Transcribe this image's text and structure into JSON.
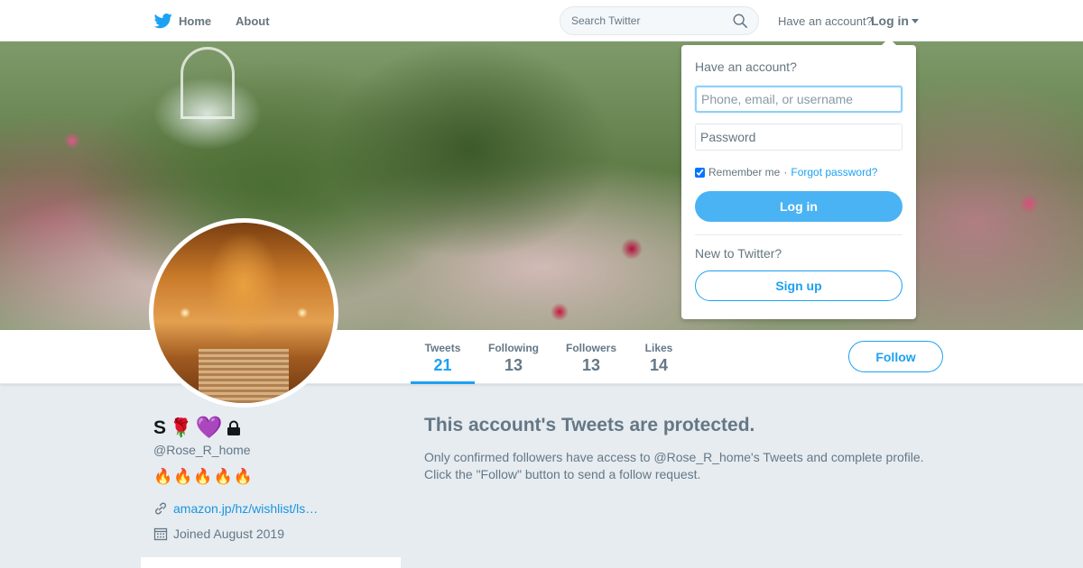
{
  "nav": {
    "home_label": "Home",
    "about_label": "About",
    "search_placeholder": "Search Twitter",
    "have_account": "Have an account?",
    "login_label": "Log in"
  },
  "login_dropdown": {
    "title": "Have an account?",
    "phone_placeholder": "Phone, email, or username",
    "password_placeholder": "Password",
    "remember_label": "Remember me",
    "separator": "·",
    "forgot_label": "Forgot password?",
    "remember_checked": true,
    "login_button": "Log in",
    "new_label": "New to Twitter?",
    "signup_button": "Sign up"
  },
  "stats": [
    {
      "label": "Tweets",
      "value": "21",
      "active": true
    },
    {
      "label": "Following",
      "value": "13",
      "active": false
    },
    {
      "label": "Followers",
      "value": "13",
      "active": false
    },
    {
      "label": "Likes",
      "value": "14",
      "active": false
    }
  ],
  "follow_button": "Follow",
  "profile": {
    "name": "S",
    "rose": "🌹",
    "heart": "💜",
    "handle": "@Rose_R_home",
    "bio": "🔥🔥🔥🔥🔥",
    "link": "amazon.jp/hz/wishlist/ls…",
    "joined": "Joined August 2019"
  },
  "protected": {
    "title": "This account's Tweets are protected.",
    "line1": "Only confirmed followers have access to @Rose_R_home's Tweets and complete profile.",
    "line2": "Click the \"Follow\" button to send a follow request."
  },
  "colors": {
    "accent": "#1da1f2",
    "login_button": "#4ab3f4",
    "muted_text": "#657786",
    "page_background": "#e6ecf0"
  },
  "icons": [
    "twitter-bird-icon",
    "search-icon",
    "chevron-down-icon",
    "lock-icon",
    "link-icon",
    "calendar-icon"
  ]
}
